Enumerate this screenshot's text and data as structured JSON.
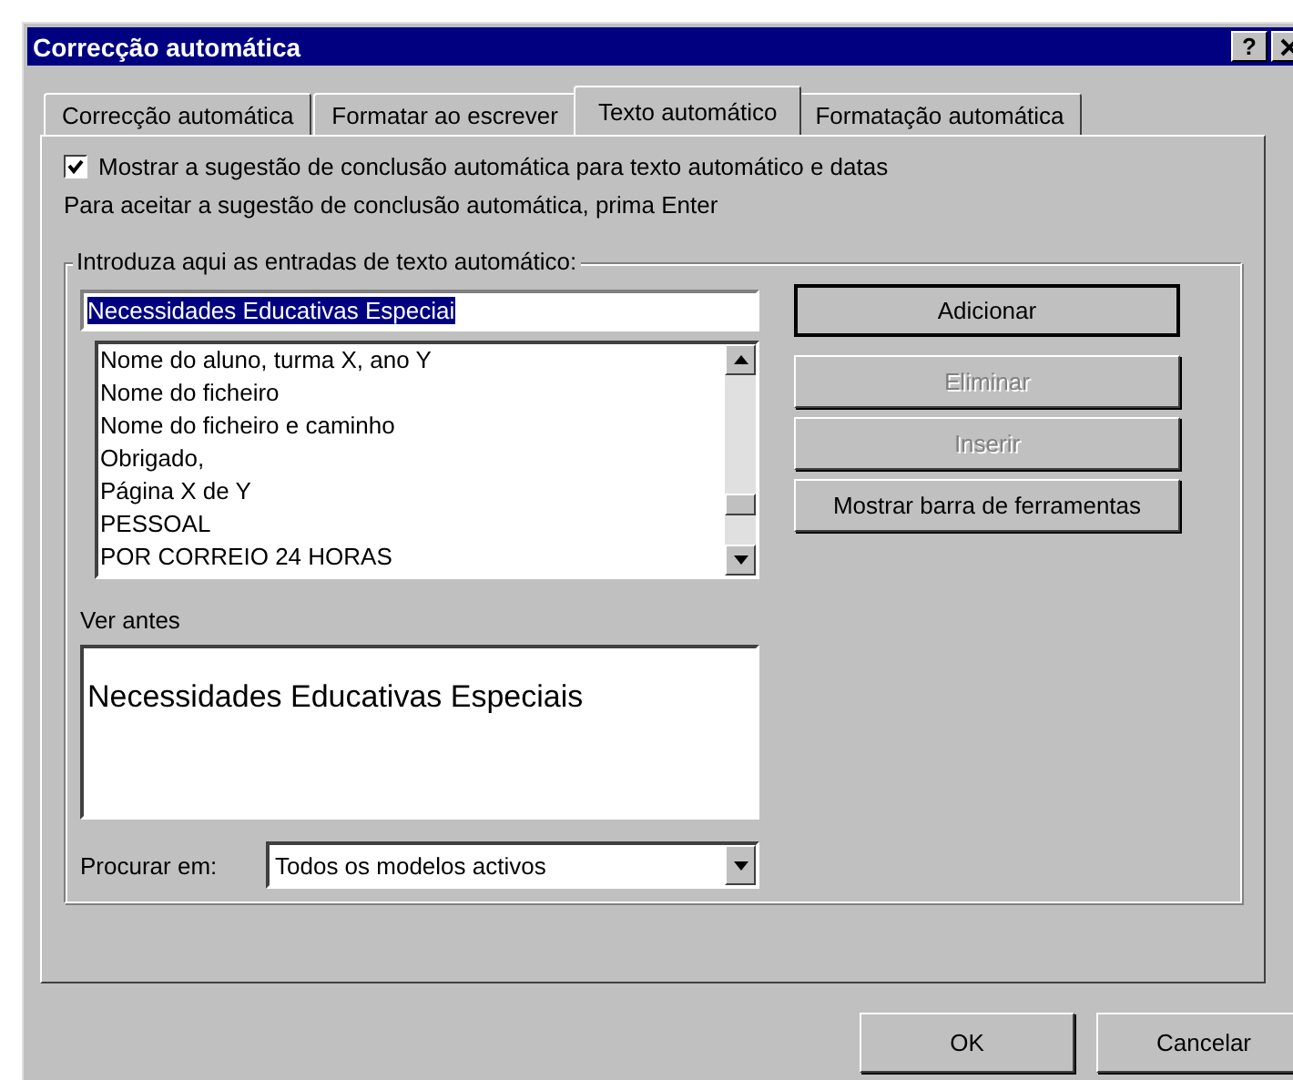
{
  "window": {
    "title": "Correcção automática",
    "help": "?"
  },
  "tabs": [
    {
      "label": "Correcção automática",
      "selected": false
    },
    {
      "label": "Formatar ao escrever",
      "selected": false
    },
    {
      "label": "Texto automático",
      "selected": true
    },
    {
      "label": "Formatação automática",
      "selected": false
    }
  ],
  "show_suggestion": {
    "label": "Mostrar a sugestão de conclusão automática para texto automático e datas",
    "checked": true
  },
  "hint": "Para aceitar a sugestão de conclusão automática, prima Enter",
  "group": {
    "title": "Introduza aqui as entradas de texto automático:",
    "entry": {
      "value": "Necessidades Educativas Especiai",
      "text_selected": true
    },
    "entries": [
      "Nome do aluno, turma X, ano Y",
      "Nome do ficheiro",
      "Nome do ficheiro e caminho",
      "Obrigado,",
      "Página X de Y",
      "PESSOAL",
      "POR CORREIO 24 HORAS"
    ],
    "buttons": [
      {
        "label": "Adicionar",
        "disabled": false,
        "default": true
      },
      {
        "label": "Eliminar",
        "disabled": true,
        "default": false
      },
      {
        "label": "Inserir",
        "disabled": true,
        "default": false
      },
      {
        "label": "Mostrar barra de ferramentas",
        "disabled": false,
        "default": false
      }
    ],
    "preview_label": "Ver antes",
    "preview": "Necessidades Educativas Especiais",
    "look_in": {
      "label": "Procurar em:",
      "value": "Todos os modelos activos"
    }
  },
  "footer_buttons": [
    "OK",
    "Cancelar"
  ]
}
